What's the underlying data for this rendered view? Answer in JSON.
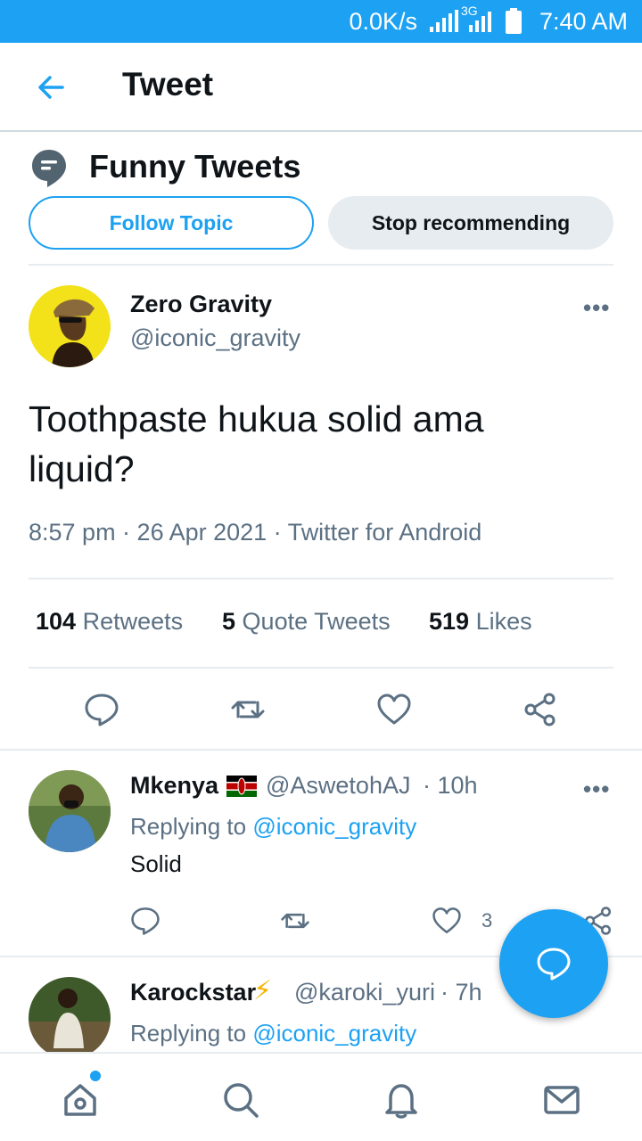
{
  "status_bar": {
    "speed": "0.0K/s",
    "network": "3G",
    "time": "7:40 AM"
  },
  "header": {
    "title": "Tweet"
  },
  "topic": {
    "title": "Funny Tweets",
    "follow_label": "Follow Topic",
    "stop_label": "Stop recommending"
  },
  "tweet": {
    "author_name": "Zero Gravity",
    "author_handle": "@iconic_gravity",
    "text": "Toothpaste hukua solid ama liquid?",
    "meta": "8:57 pm · 26 Apr 2021 · Twitter for Android",
    "retweets_count": "104",
    "retweets_label": "Retweets",
    "quotes_count": "5",
    "quotes_label": "Quote Tweets",
    "likes_count": "519",
    "likes_label": "Likes"
  },
  "replies": [
    {
      "name": "Mkenya",
      "handle": "@AswetohAJ",
      "time": "· 10h",
      "replying_prefix": "Replying to",
      "replying_to": "@iconic_gravity",
      "text": "Solid",
      "likes": "3"
    },
    {
      "name": "Karockstar",
      "emoji": "⚡",
      "handle": "@karoki_yuri",
      "time": "· 7h",
      "replying_prefix": "Replying to",
      "replying_to": "@iconic_gravity"
    }
  ],
  "more_glyph": "•••",
  "colors": {
    "accent": "#1da1f2",
    "text_primary": "#0f1419",
    "text_secondary": "#5b7083"
  }
}
